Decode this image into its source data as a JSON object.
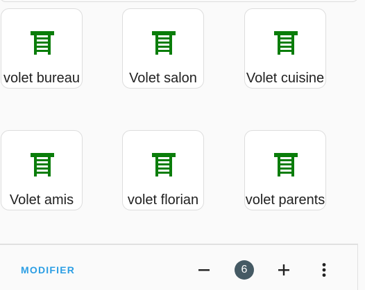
{
  "tiles": [
    {
      "label": "volet bureau",
      "icon": "garage-shutter-icon"
    },
    {
      "label": "Volet salon",
      "icon": "garage-shutter-icon"
    },
    {
      "label": "Volet cuisine",
      "icon": "garage-shutter-icon"
    },
    {
      "label": "Volet amis",
      "icon": "garage-shutter-icon"
    },
    {
      "label": "volet florian",
      "icon": "garage-shutter-icon"
    },
    {
      "label": "volet parents",
      "icon": "garage-shutter-icon"
    }
  ],
  "colors": {
    "icon": "#0a7d0a",
    "accent": "#2b9ee4",
    "badge": "#455a64"
  },
  "toolbar": {
    "edit_label": "MODIFIER",
    "count": "6",
    "minus_icon": "minus-icon",
    "plus_icon": "plus-icon",
    "menu_icon": "more-vertical-icon"
  }
}
